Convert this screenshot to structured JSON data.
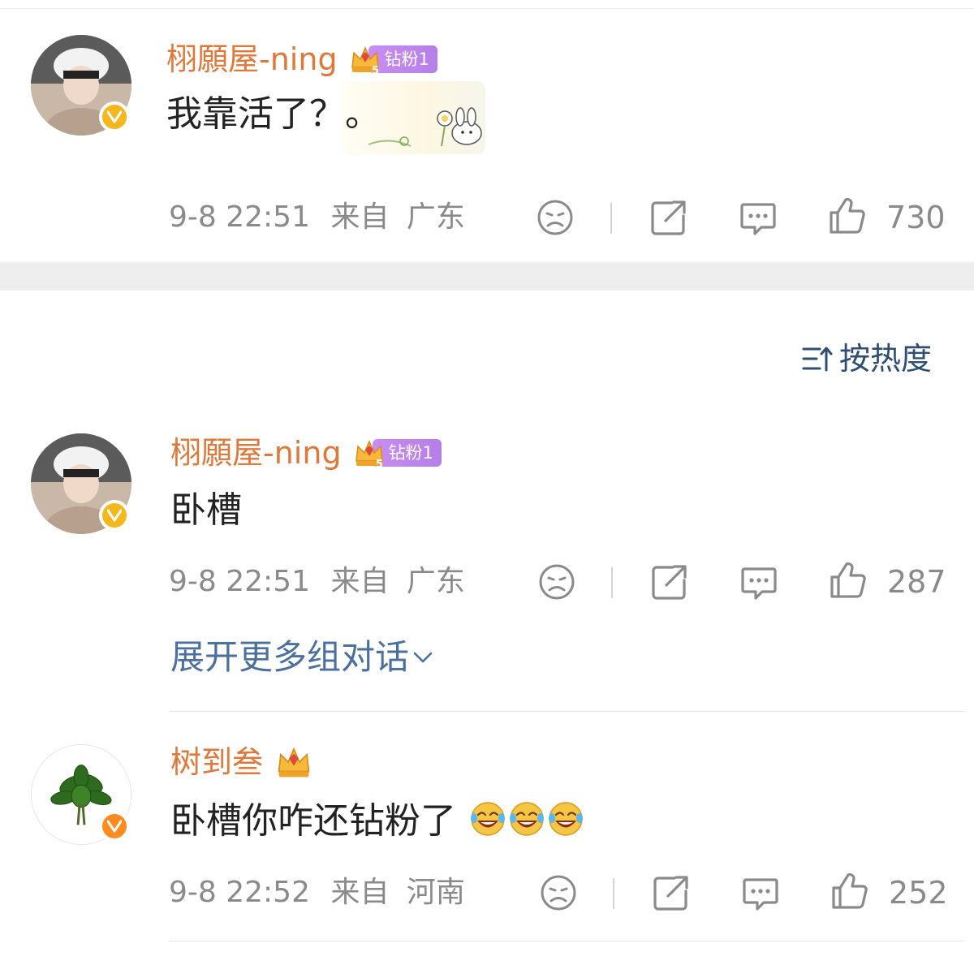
{
  "comments": [
    {
      "username": "栩願屋-ning",
      "badge_level": "5",
      "badge_label": "钻粉1",
      "text": "我靠活了？。",
      "time": "9-8 22:51",
      "from_label": "来自",
      "location": "广东",
      "likes": "730"
    },
    {
      "username": "栩願屋-ning",
      "badge_level": "5",
      "badge_label": "钻粉1",
      "text": "卧槽",
      "time": "9-8 22:51",
      "from_label": "来自",
      "location": "广东",
      "likes": "287"
    },
    {
      "username": "树到叁",
      "text": "卧槽你咋还钻粉了",
      "time": "9-8 22:52",
      "from_label": "来自",
      "location": "河南",
      "likes": "252"
    }
  ],
  "sort": {
    "label": "按热度"
  },
  "thread": {
    "expand_label": "展开更多组对话"
  },
  "colors": {
    "username": "#e0783a",
    "link": "#4b6f9f",
    "meta": "#8a8a8a",
    "badge_purple": "#c98df2"
  }
}
